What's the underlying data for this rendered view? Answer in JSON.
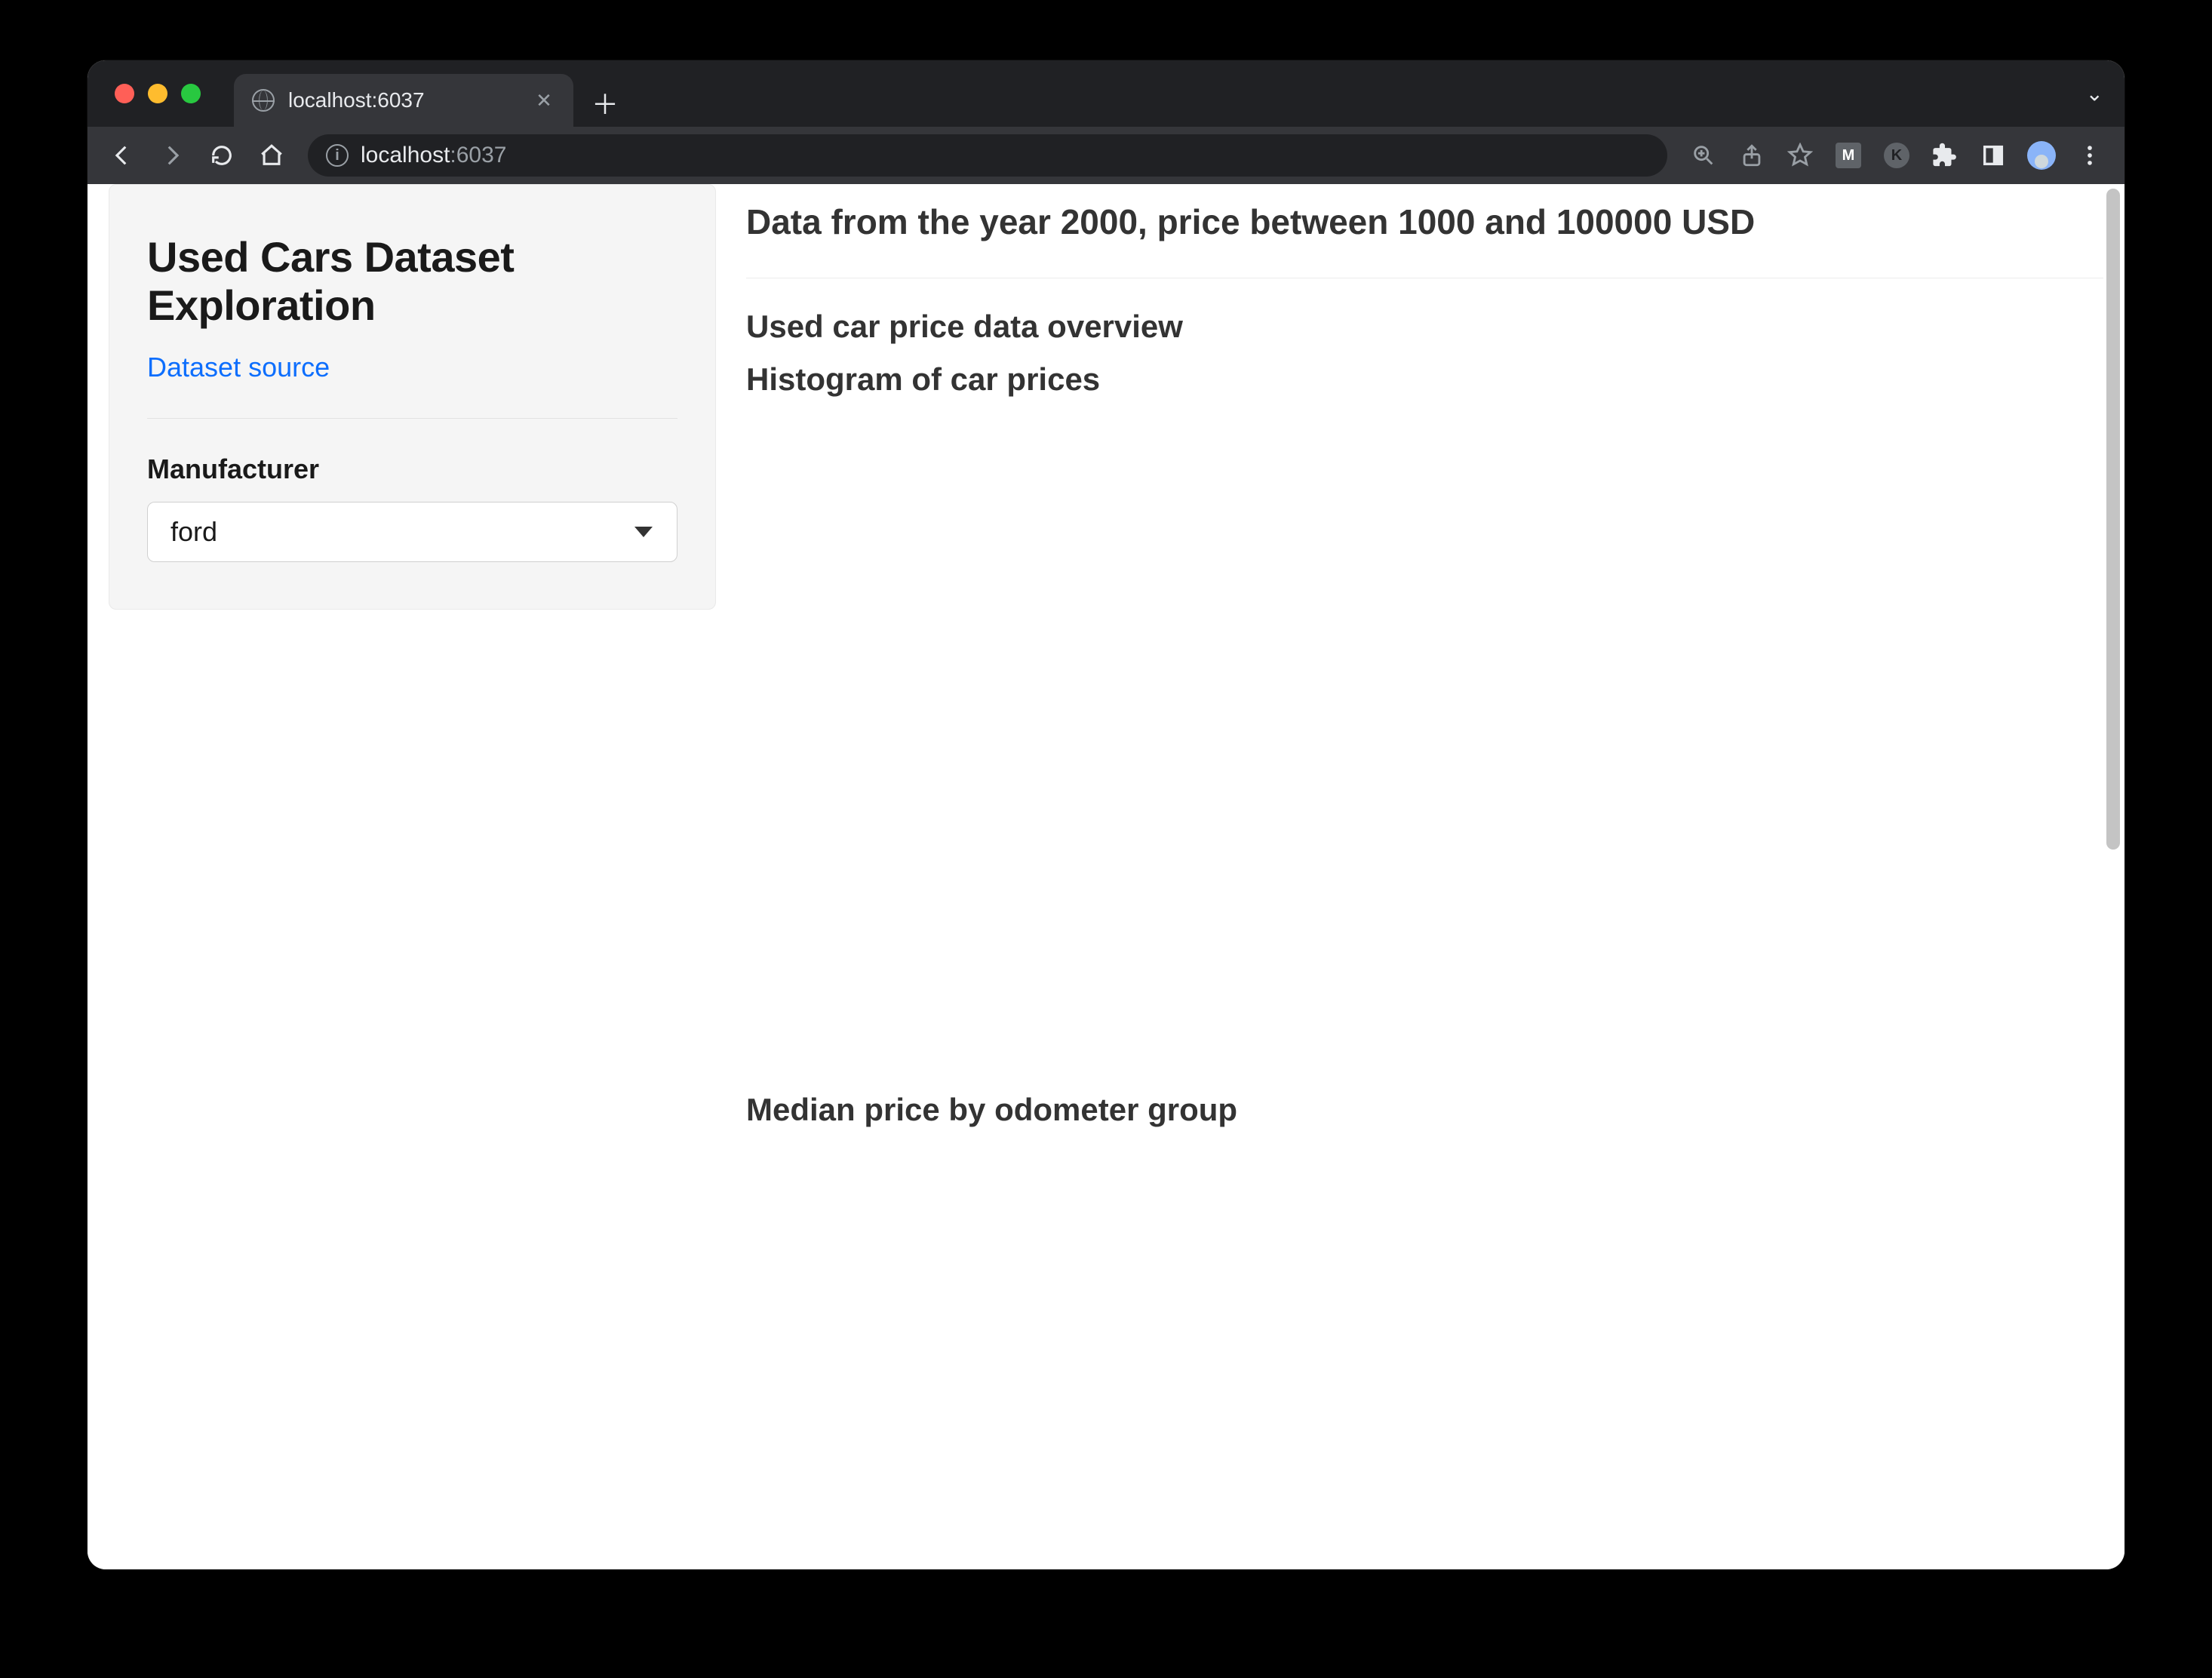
{
  "browser": {
    "tab_title": "localhost:6037",
    "url_host": "localhost",
    "url_port": ":6037"
  },
  "sidebar": {
    "title": "Used Cars Dataset Exploration",
    "dataset_link_label": "Dataset source",
    "manufacturer_label": "Manufacturer",
    "manufacturer_value": "ford"
  },
  "main": {
    "heading": "Data from the year 2000, price between 1000 and 100000 USD",
    "overview_heading": "Used car price data overview",
    "histogram_heading": "Histogram of car prices",
    "median_heading": "Median price by odometer group"
  }
}
